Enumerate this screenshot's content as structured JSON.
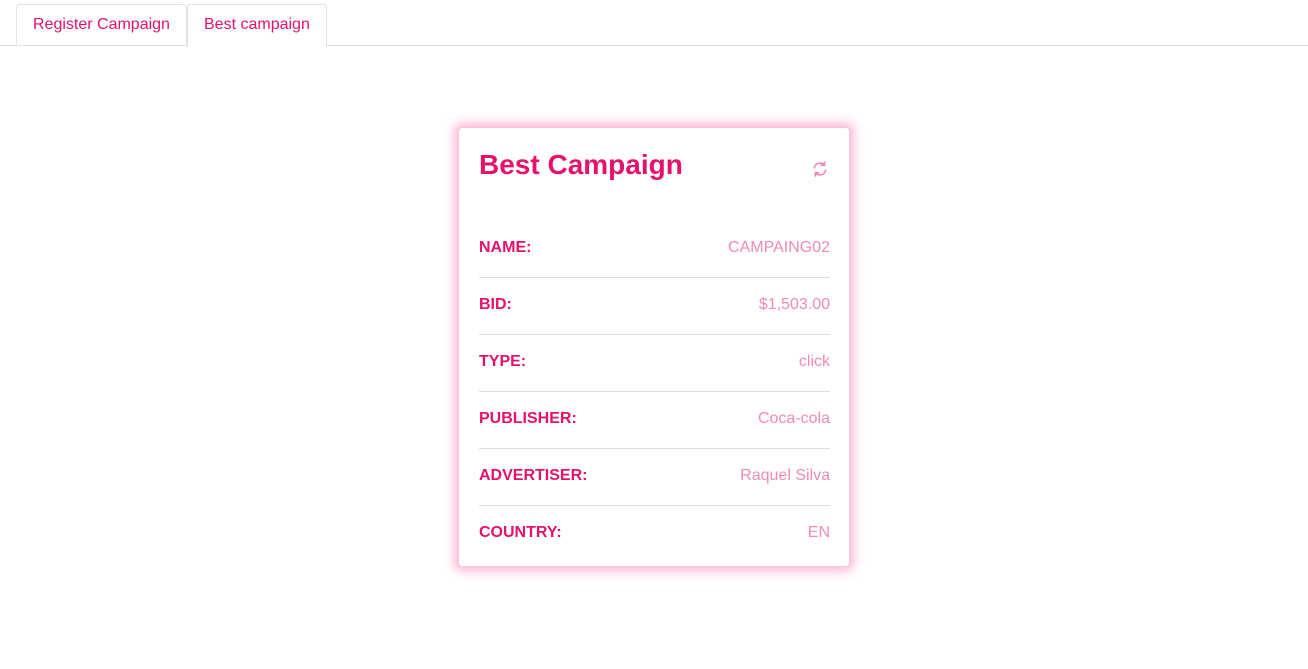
{
  "tabs": [
    {
      "label": "Register Campaign",
      "active": false
    },
    {
      "label": "Best campaign",
      "active": true
    }
  ],
  "card": {
    "title": "Best Campaign",
    "refresh_icon": "refresh-icon",
    "rows": [
      {
        "label": "NAME:",
        "value": "CAMPAING02"
      },
      {
        "label": "BID:",
        "value": "$1,503.00"
      },
      {
        "label": "TYPE:",
        "value": "click"
      },
      {
        "label": "PUBLISHER:",
        "value": "Coca-cola"
      },
      {
        "label": "ADVERTISER:",
        "value": "Raquel Silva"
      },
      {
        "label": "COUNTRY:",
        "value": "EN"
      }
    ]
  },
  "colors": {
    "accent": "#e5116d",
    "value_text": "#f08ab7",
    "card_glow": "#ff5aa5"
  }
}
